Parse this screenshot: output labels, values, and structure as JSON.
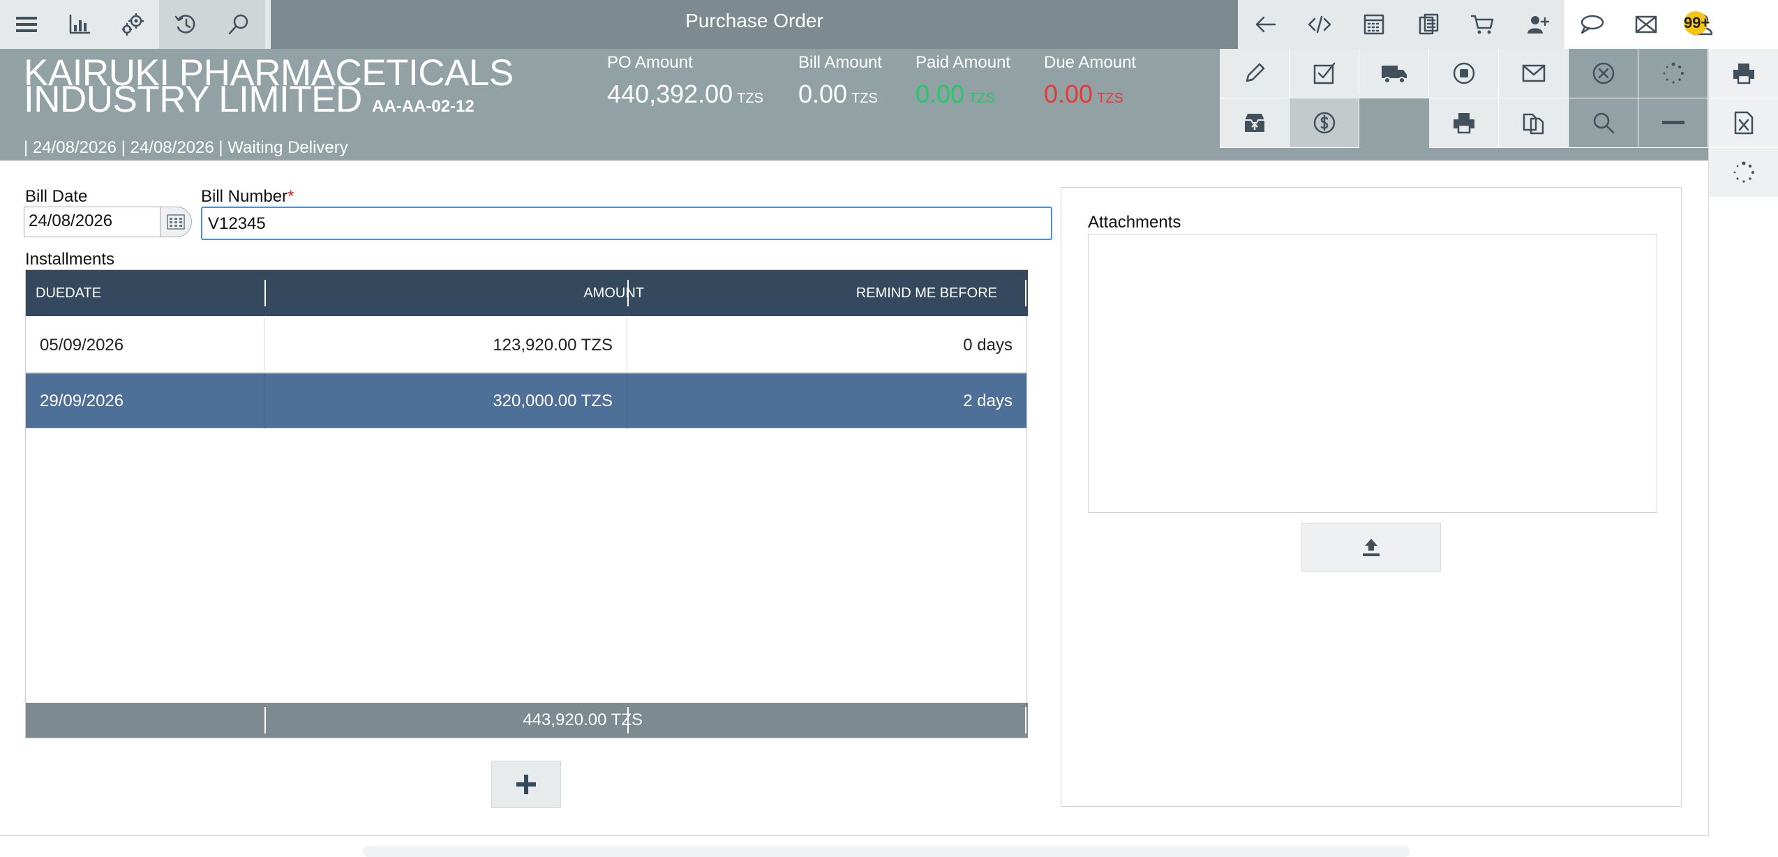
{
  "app": {
    "title": "Purchase Order"
  },
  "toolbar_left": [
    "menu-icon",
    "chart-icon",
    "settings-gear-icon",
    "history-icon",
    "search-icon"
  ],
  "toolbar_right": [
    "back-arrow-icon",
    "code-icon",
    "calculator-icon",
    "clipboard-icon",
    "cart-icon",
    "user-add-icon",
    "chat-icon",
    "mail-icon",
    "user-icon"
  ],
  "notifications": {
    "badge": "99+"
  },
  "header": {
    "company": "KAIRUKI PHARMACETICALS INDUSTRY LIMITED",
    "company_line1": "KAIRUKI PHARMACETICALS",
    "company_line2": "INDUSTRY LIMITED",
    "code": "AA-AA-02-12",
    "meta": "| 24/08/2026 | 24/08/2026 | Waiting Delivery",
    "amounts": {
      "po": {
        "label": "PO Amount",
        "value": "440,392.00",
        "currency": "TZS"
      },
      "bill": {
        "label": "Bill Amount",
        "value": "0.00",
        "currency": "TZS"
      },
      "paid": {
        "label": "Paid Amount",
        "value": "0.00",
        "currency": "TZS"
      },
      "due": {
        "label": "Due Amount",
        "value": "0.00",
        "currency": "TZS"
      }
    },
    "colors": {
      "paid": "#27c76a",
      "due": "#e53935"
    }
  },
  "actions": {
    "row1": [
      "edit-pencil-icon",
      "checkbox-check-icon",
      "truck-icon",
      "stop-circle-icon",
      "mail-icon",
      "cancel-circle-icon",
      "loading-spinner-icon"
    ],
    "row2": [
      "archive-box-icon",
      "dollar-circle-icon",
      "printer-icon",
      "copy-icon",
      "search-icon",
      "minus-icon"
    ],
    "side": [
      "printer-icon",
      "excel-icon",
      "loading-spinner-icon"
    ]
  },
  "form": {
    "bill_date_label": "Bill Date",
    "bill_date": "24/08/2026",
    "bill_number_label": "Bill Number",
    "required_mark": "*",
    "bill_number": "V12345"
  },
  "installments": {
    "title": "Installments",
    "columns": [
      "DUEDATE",
      "AMOUNT",
      "REMIND ME BEFORE"
    ],
    "rows": [
      {
        "duedate": "05/09/2026",
        "amount": "123,920.00 TZS",
        "remind": "0 days"
      },
      {
        "duedate": "29/09/2026",
        "amount": "320,000.00 TZS",
        "remind": "2 days"
      }
    ],
    "total": "443,920.00 TZS"
  },
  "attachments": {
    "title": "Attachments"
  },
  "colors": {
    "accent": "#4d6f98",
    "header_bg": "#91a1a4",
    "topbar": "#7d8a8f",
    "grid_head": "#34495e"
  }
}
